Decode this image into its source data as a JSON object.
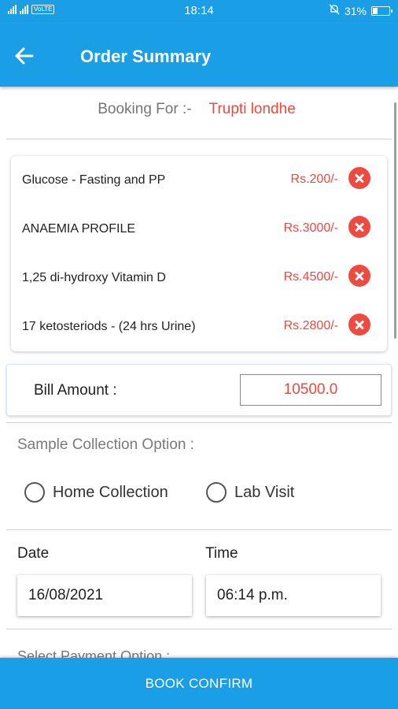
{
  "status_bar": {
    "time": "18:14",
    "battery": "31%",
    "network_badge": "VoLTE",
    "battery_fraction": 0.31
  },
  "app_bar": {
    "title": "Order Summary",
    "back_icon": "arrow-left-icon"
  },
  "booking": {
    "label": "Booking For :-",
    "name": "Trupti londhe"
  },
  "tests": [
    {
      "name": "Glucose - Fasting and PP",
      "price": "Rs.200/-"
    },
    {
      "name": "ANAEMIA PROFILE",
      "price": "Rs.3000/-"
    },
    {
      "name": "1,25 di-hydroxy Vitamin D",
      "price": "Rs.4500/-"
    },
    {
      "name": "17 ketosteriods - (24 hrs Urine)",
      "price": "Rs.2800/-"
    }
  ],
  "bill": {
    "label": "Bill Amount :",
    "value": "10500.0"
  },
  "sample_collection": {
    "title": "Sample Collection Option :",
    "options": [
      "Home Collection",
      "Lab Visit"
    ]
  },
  "schedule": {
    "date_label": "Date",
    "date_value": "16/08/2021",
    "time_label": "Time",
    "time_value": "06:14 p.m."
  },
  "payment": {
    "title": "Select Payment Option :"
  },
  "confirm_button": "BOOK CONFIRM",
  "colors": {
    "primary": "#1a9ee6",
    "accent_red": "#f0473e"
  }
}
